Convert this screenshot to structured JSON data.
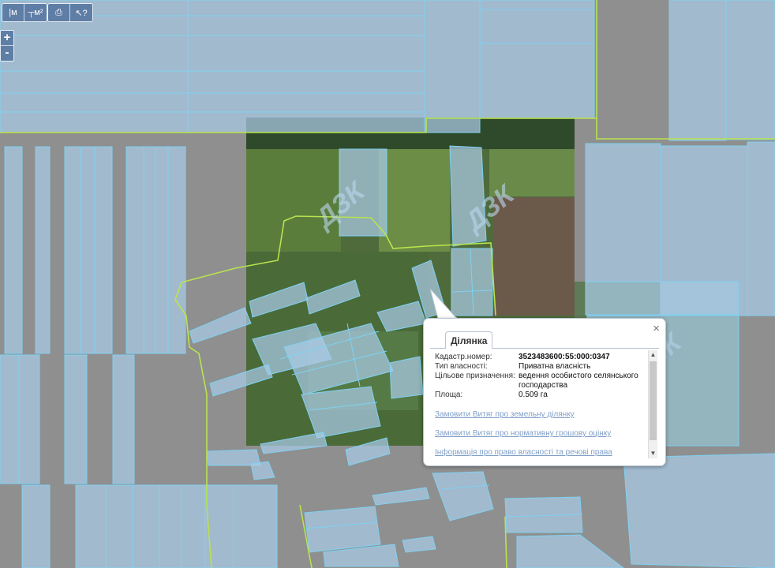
{
  "toolbar": {
    "tools": [
      {
        "name": "measure-distance-icon",
        "glyph": "|м"
      },
      {
        "name": "measure-area-icon",
        "glyph": "┬м²"
      },
      {
        "name": "print-icon",
        "glyph": "⎙"
      },
      {
        "name": "identify-icon",
        "glyph": "↖?"
      }
    ]
  },
  "zoom": {
    "in_label": "+",
    "out_label": "-"
  },
  "watermark": "ДЗК",
  "colors": {
    "background": "#8f8f8f",
    "parcel_fill": "#a9cbe6",
    "parcel_stroke": "#7fd1f2",
    "boundary_line": "#b9e34d",
    "imagery": "#4f6b3c",
    "ui_button": "#5f7ea6",
    "link": "#7f9fc7"
  },
  "popup": {
    "tab_label": "Ділянка",
    "close_glyph": "×",
    "fields": [
      {
        "key": "Кадастр.номер:",
        "value": "3523483600:55:000:0347",
        "bold": true
      },
      {
        "key": "Тип власності:",
        "value": "Приватна власність",
        "bold": false
      },
      {
        "key": "Цільове призначення:",
        "value": "ведення особистого селянського господарства",
        "bold": false
      },
      {
        "key": "Площа:",
        "value": "0.509 га",
        "bold": false
      }
    ],
    "links": [
      "Замовити Витяг про земельну ділянку",
      "Замовити Витяг про нормативну грошову оцінку",
      "Інформація про право власності та речові права"
    ]
  }
}
